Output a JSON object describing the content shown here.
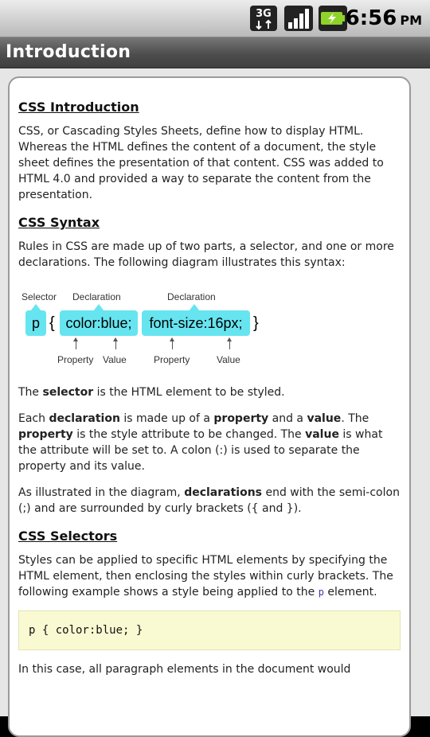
{
  "status": {
    "time": "6:56",
    "ampm": "PM",
    "network_badge": "3G"
  },
  "title": "Introduction",
  "sections": {
    "intro": {
      "heading": "CSS Introduction",
      "body": "CSS, or Cascading Styles Sheets, define how to display HTML. Whereas the HTML defines the content of a document, the style sheet defines the presentation of that content. CSS was added to HTML 4.0 and provided a way to separate the content from the presentation."
    },
    "syntax": {
      "heading": "CSS Syntax",
      "body": "Rules in CSS are made up of two parts, a selector, and one or more declarations. The following diagram illustrates this syntax:"
    },
    "diagram": {
      "label_selector": "Selector",
      "label_declaration_1": "Declaration",
      "label_declaration_2": "Declaration",
      "selector": "p",
      "open_brace": "{",
      "declaration_1": "color:blue;",
      "declaration_2": "font-size:16px;",
      "close_brace": "}",
      "label_property_1": "Property",
      "label_value_1": "Value",
      "label_property_2": "Property",
      "label_value_2": "Value"
    },
    "selector_para": {
      "pre": "The ",
      "bold": "selector",
      "post": " is the HTML element to be styled."
    },
    "declaration_para": {
      "t1": "Each ",
      "b1": "declaration",
      "t2": " is made up of a ",
      "b2": "property",
      "t3": " and a ",
      "b3": "value",
      "t4": ". The ",
      "b4": "property",
      "t5": " is the style attribute to be changed. The ",
      "b5": "value",
      "t6": " is what the attribute will be set to. A colon (:) is used to separate the property and its value."
    },
    "illustrated_para": {
      "pre": "As illustrated in the diagram, ",
      "bold": "declarations",
      "post": " end with the semi-colon (;) and are surrounded by curly brackets ({ and })."
    },
    "selectors": {
      "heading": "CSS Selectors",
      "body_pre": "Styles can be applied to specific HTML elements by specifying the HTML element, then enclosing the styles within curly brackets. The following example shows a style being applied to the ",
      "body_code": "p",
      "body_post": " element."
    },
    "code_example": "p { color:blue; }",
    "trailing": "In this case, all paragraph elements in the document would"
  },
  "colors": {
    "diagram_box": "#66e5f0",
    "code_bg": "#fafad2",
    "titlebar": "#4e4e4e"
  }
}
